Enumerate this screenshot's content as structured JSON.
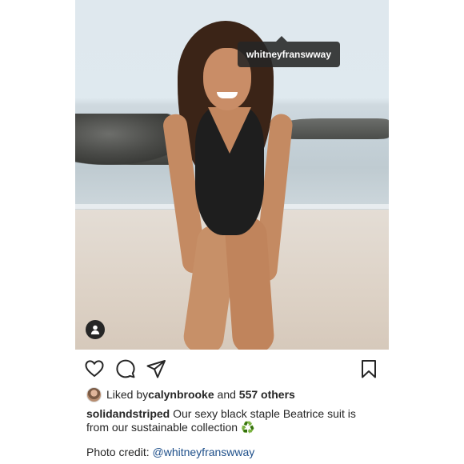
{
  "photo": {
    "tag_username": "whitneyfranswway",
    "icons": {
      "user_tag": "person-icon"
    }
  },
  "actions": {
    "icons": [
      "heart-icon",
      "comment-icon",
      "share-icon",
      "bookmark-icon"
    ]
  },
  "likes": {
    "prefix": "Liked by ",
    "user": "calynbrooke",
    "joiner": " and ",
    "others": "557 others"
  },
  "caption": {
    "username": "solidandstriped",
    "text": " Our sexy black staple Beatrice suit is from our sustainable collection ",
    "emoji": "♻️"
  },
  "credit": {
    "label": "Photo credit: ",
    "mention": "@whitneyfranswway"
  },
  "colors": {
    "text": "#262626",
    "mention": "#1e4f8a",
    "tag_bg": "#262626",
    "recycle": "#2e9e3f"
  }
}
